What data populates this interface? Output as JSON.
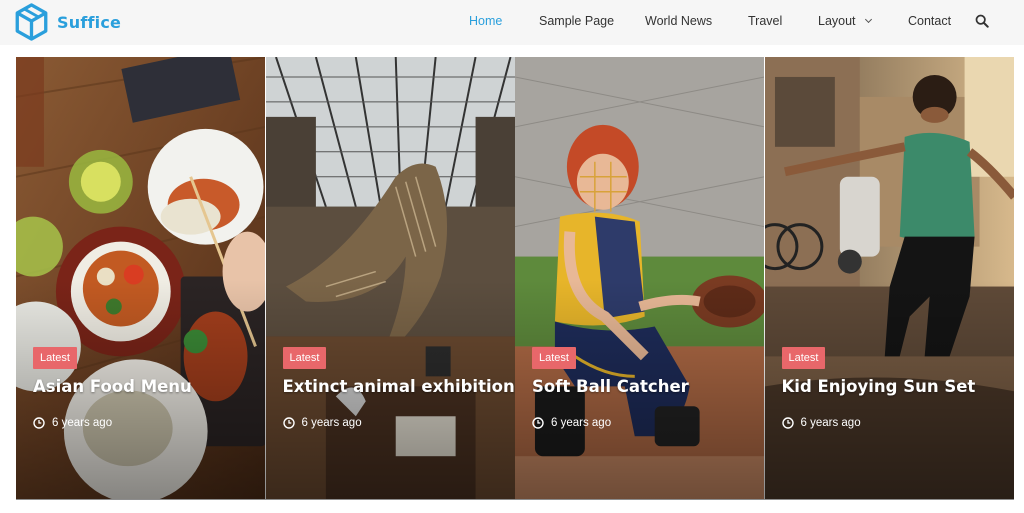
{
  "brand": {
    "name": "Suffice",
    "logo_icon": "cube-logo-icon",
    "color": "#2a9fdc"
  },
  "nav": {
    "items": [
      {
        "label": "Home",
        "active": true
      },
      {
        "label": "Sample Page",
        "active": false
      },
      {
        "label": "World News",
        "active": false
      },
      {
        "label": "Travel",
        "active": false
      },
      {
        "label": "Layout",
        "active": false,
        "has_dropdown": true
      },
      {
        "label": "Contact",
        "active": false
      }
    ],
    "search_icon": "search-icon"
  },
  "posts": [
    {
      "badge": "Latest",
      "title": "Asian Food Menu",
      "time": "6 years ago"
    },
    {
      "badge": "Latest",
      "title": "Extinct animal exhibition",
      "time": "6 years ago"
    },
    {
      "badge": "Latest",
      "title": "Soft Ball Catcher",
      "time": "6 years ago"
    },
    {
      "badge": "Latest",
      "title": "Kid Enjoying Sun Set",
      "time": "6 years ago"
    }
  ],
  "colors": {
    "accent": "#2a9fdc",
    "badge": "#e8676a",
    "header_bg": "#f6f6f6"
  }
}
